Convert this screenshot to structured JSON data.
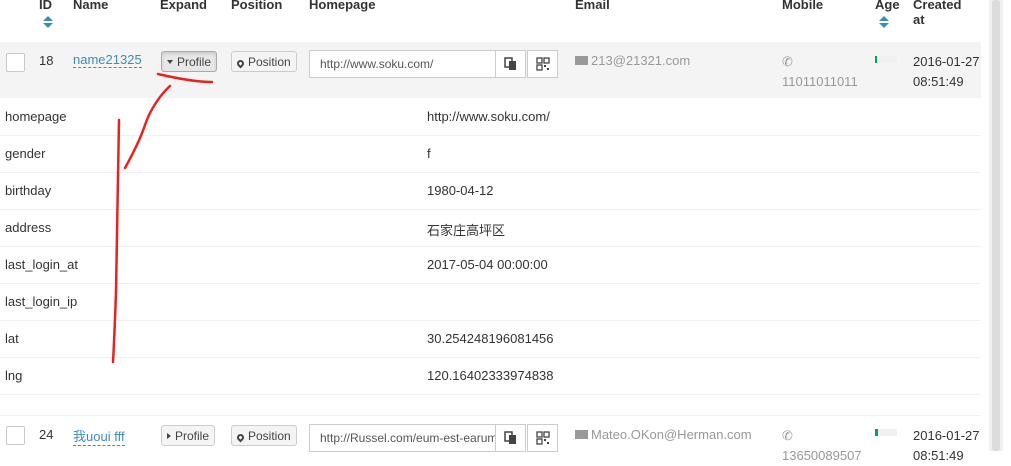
{
  "columns": {
    "id": "ID",
    "name": "Name",
    "expand": "Expand",
    "position": "Position",
    "homepage": "Homepage",
    "email": "Email",
    "mobile": "Mobile",
    "age": "Age",
    "created_line1": "Created",
    "created_line2": "at"
  },
  "rows": [
    {
      "id": "18",
      "name": "name21325",
      "expand_label": "Profile",
      "position_label": "Position",
      "homepage": "http://www.soku.com/",
      "email": "213@21321.com",
      "mobile": "11011011011",
      "age_percent": 8,
      "created_date": "2016-01-27",
      "created_time": "08:51:49"
    },
    {
      "id": "24",
      "name": "我uoui fff",
      "expand_label": "Profile",
      "position_label": "Position",
      "homepage": "http://Russel.com/eum-est-earum",
      "email": "Mateo.OKon@Herman.com",
      "mobile": "13650089507",
      "age_percent": 12,
      "created_date": "2016-01-27",
      "created_time": "08:51:49"
    }
  ],
  "profile": [
    {
      "key": "homepage",
      "value": "http://www.soku.com/"
    },
    {
      "key": "gender",
      "value": "f"
    },
    {
      "key": "birthday",
      "value": "1980-04-12"
    },
    {
      "key": "address",
      "value": "石家庄高坪区"
    },
    {
      "key": "last_login_at",
      "value": "2017-05-04 00:00:00"
    },
    {
      "key": "last_login_ip",
      "value": ""
    },
    {
      "key": "lat",
      "value": "30.254248196081456"
    },
    {
      "key": "lng",
      "value": "120.16402333974838"
    }
  ],
  "icons": {
    "copy": "copy-icon",
    "qrcode": "qrcode-icon",
    "envelope": "envelope-icon",
    "phone": "phone-icon",
    "map_marker": "map-marker-icon",
    "caret": "caret-icon"
  },
  "colors": {
    "link": "#3c8dbc",
    "age_bar": "#00a65a",
    "annotation": "#e8231f"
  }
}
